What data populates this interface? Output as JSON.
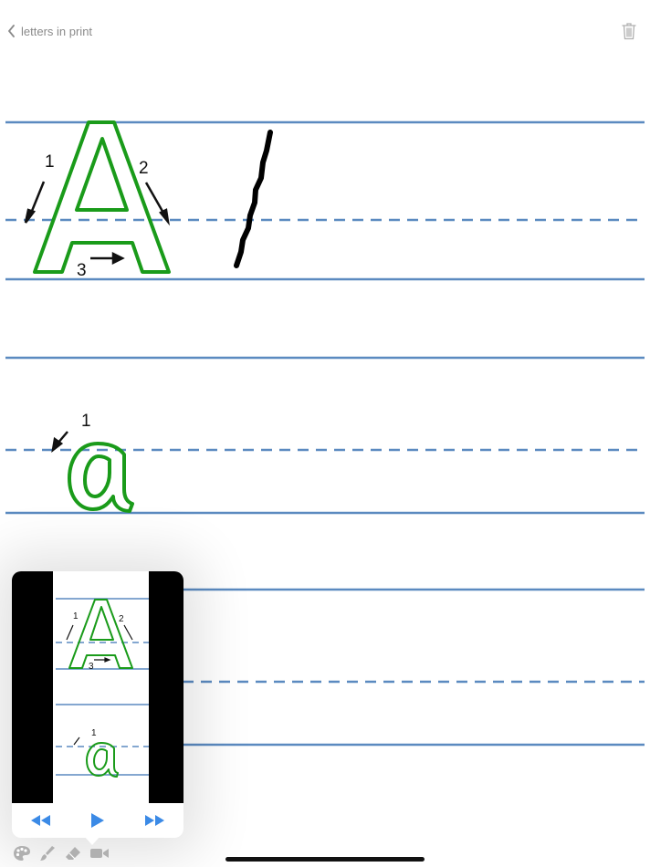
{
  "nav": {
    "back_label": "letters in print"
  },
  "guide": {
    "upper": {
      "letter": "A",
      "step_1": "1",
      "step_2": "2",
      "step_3": "3"
    },
    "lower": {
      "letter": "a",
      "step_1": "1"
    }
  },
  "icons": {
    "back": "chevron-left-icon",
    "trash": "trash-icon",
    "rewind": "rewind-icon",
    "play": "play-icon",
    "fast_forward": "fast-forward-icon",
    "palette": "palette-icon",
    "brush": "brush-icon",
    "eraser": "eraser-icon",
    "video": "video-camera-icon"
  },
  "colors": {
    "guide_line": "#5b8ac0",
    "letter_outline": "#1a9b1a",
    "stroke": "#000000",
    "accent": "#3b8ae6",
    "toolbar_icon": "#b0b0b0"
  }
}
